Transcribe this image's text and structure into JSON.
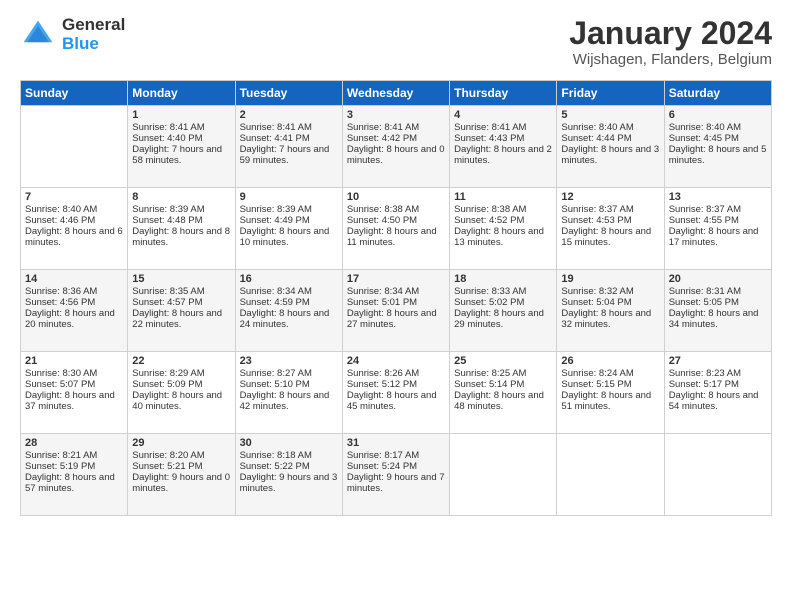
{
  "header": {
    "logo_general": "General",
    "logo_blue": "Blue",
    "month_year": "January 2024",
    "location": "Wijshagen, Flanders, Belgium"
  },
  "days_of_week": [
    "Sunday",
    "Monday",
    "Tuesday",
    "Wednesday",
    "Thursday",
    "Friday",
    "Saturday"
  ],
  "weeks": [
    [
      {
        "day": "",
        "sunrise": "",
        "sunset": "",
        "daylight": ""
      },
      {
        "day": "1",
        "sunrise": "Sunrise: 8:41 AM",
        "sunset": "Sunset: 4:40 PM",
        "daylight": "Daylight: 7 hours and 58 minutes."
      },
      {
        "day": "2",
        "sunrise": "Sunrise: 8:41 AM",
        "sunset": "Sunset: 4:41 PM",
        "daylight": "Daylight: 7 hours and 59 minutes."
      },
      {
        "day": "3",
        "sunrise": "Sunrise: 8:41 AM",
        "sunset": "Sunset: 4:42 PM",
        "daylight": "Daylight: 8 hours and 0 minutes."
      },
      {
        "day": "4",
        "sunrise": "Sunrise: 8:41 AM",
        "sunset": "Sunset: 4:43 PM",
        "daylight": "Daylight: 8 hours and 2 minutes."
      },
      {
        "day": "5",
        "sunrise": "Sunrise: 8:40 AM",
        "sunset": "Sunset: 4:44 PM",
        "daylight": "Daylight: 8 hours and 3 minutes."
      },
      {
        "day": "6",
        "sunrise": "Sunrise: 8:40 AM",
        "sunset": "Sunset: 4:45 PM",
        "daylight": "Daylight: 8 hours and 5 minutes."
      }
    ],
    [
      {
        "day": "7",
        "sunrise": "Sunrise: 8:40 AM",
        "sunset": "Sunset: 4:46 PM",
        "daylight": "Daylight: 8 hours and 6 minutes."
      },
      {
        "day": "8",
        "sunrise": "Sunrise: 8:39 AM",
        "sunset": "Sunset: 4:48 PM",
        "daylight": "Daylight: 8 hours and 8 minutes."
      },
      {
        "day": "9",
        "sunrise": "Sunrise: 8:39 AM",
        "sunset": "Sunset: 4:49 PM",
        "daylight": "Daylight: 8 hours and 10 minutes."
      },
      {
        "day": "10",
        "sunrise": "Sunrise: 8:38 AM",
        "sunset": "Sunset: 4:50 PM",
        "daylight": "Daylight: 8 hours and 11 minutes."
      },
      {
        "day": "11",
        "sunrise": "Sunrise: 8:38 AM",
        "sunset": "Sunset: 4:52 PM",
        "daylight": "Daylight: 8 hours and 13 minutes."
      },
      {
        "day": "12",
        "sunrise": "Sunrise: 8:37 AM",
        "sunset": "Sunset: 4:53 PM",
        "daylight": "Daylight: 8 hours and 15 minutes."
      },
      {
        "day": "13",
        "sunrise": "Sunrise: 8:37 AM",
        "sunset": "Sunset: 4:55 PM",
        "daylight": "Daylight: 8 hours and 17 minutes."
      }
    ],
    [
      {
        "day": "14",
        "sunrise": "Sunrise: 8:36 AM",
        "sunset": "Sunset: 4:56 PM",
        "daylight": "Daylight: 8 hours and 20 minutes."
      },
      {
        "day": "15",
        "sunrise": "Sunrise: 8:35 AM",
        "sunset": "Sunset: 4:57 PM",
        "daylight": "Daylight: 8 hours and 22 minutes."
      },
      {
        "day": "16",
        "sunrise": "Sunrise: 8:34 AM",
        "sunset": "Sunset: 4:59 PM",
        "daylight": "Daylight: 8 hours and 24 minutes."
      },
      {
        "day": "17",
        "sunrise": "Sunrise: 8:34 AM",
        "sunset": "Sunset: 5:01 PM",
        "daylight": "Daylight: 8 hours and 27 minutes."
      },
      {
        "day": "18",
        "sunrise": "Sunrise: 8:33 AM",
        "sunset": "Sunset: 5:02 PM",
        "daylight": "Daylight: 8 hours and 29 minutes."
      },
      {
        "day": "19",
        "sunrise": "Sunrise: 8:32 AM",
        "sunset": "Sunset: 5:04 PM",
        "daylight": "Daylight: 8 hours and 32 minutes."
      },
      {
        "day": "20",
        "sunrise": "Sunrise: 8:31 AM",
        "sunset": "Sunset: 5:05 PM",
        "daylight": "Daylight: 8 hours and 34 minutes."
      }
    ],
    [
      {
        "day": "21",
        "sunrise": "Sunrise: 8:30 AM",
        "sunset": "Sunset: 5:07 PM",
        "daylight": "Daylight: 8 hours and 37 minutes."
      },
      {
        "day": "22",
        "sunrise": "Sunrise: 8:29 AM",
        "sunset": "Sunset: 5:09 PM",
        "daylight": "Daylight: 8 hours and 40 minutes."
      },
      {
        "day": "23",
        "sunrise": "Sunrise: 8:27 AM",
        "sunset": "Sunset: 5:10 PM",
        "daylight": "Daylight: 8 hours and 42 minutes."
      },
      {
        "day": "24",
        "sunrise": "Sunrise: 8:26 AM",
        "sunset": "Sunset: 5:12 PM",
        "daylight": "Daylight: 8 hours and 45 minutes."
      },
      {
        "day": "25",
        "sunrise": "Sunrise: 8:25 AM",
        "sunset": "Sunset: 5:14 PM",
        "daylight": "Daylight: 8 hours and 48 minutes."
      },
      {
        "day": "26",
        "sunrise": "Sunrise: 8:24 AM",
        "sunset": "Sunset: 5:15 PM",
        "daylight": "Daylight: 8 hours and 51 minutes."
      },
      {
        "day": "27",
        "sunrise": "Sunrise: 8:23 AM",
        "sunset": "Sunset: 5:17 PM",
        "daylight": "Daylight: 8 hours and 54 minutes."
      }
    ],
    [
      {
        "day": "28",
        "sunrise": "Sunrise: 8:21 AM",
        "sunset": "Sunset: 5:19 PM",
        "daylight": "Daylight: 8 hours and 57 minutes."
      },
      {
        "day": "29",
        "sunrise": "Sunrise: 8:20 AM",
        "sunset": "Sunset: 5:21 PM",
        "daylight": "Daylight: 9 hours and 0 minutes."
      },
      {
        "day": "30",
        "sunrise": "Sunrise: 8:18 AM",
        "sunset": "Sunset: 5:22 PM",
        "daylight": "Daylight: 9 hours and 3 minutes."
      },
      {
        "day": "31",
        "sunrise": "Sunrise: 8:17 AM",
        "sunset": "Sunset: 5:24 PM",
        "daylight": "Daylight: 9 hours and 7 minutes."
      },
      {
        "day": "",
        "sunrise": "",
        "sunset": "",
        "daylight": ""
      },
      {
        "day": "",
        "sunrise": "",
        "sunset": "",
        "daylight": ""
      },
      {
        "day": "",
        "sunrise": "",
        "sunset": "",
        "daylight": ""
      }
    ]
  ]
}
